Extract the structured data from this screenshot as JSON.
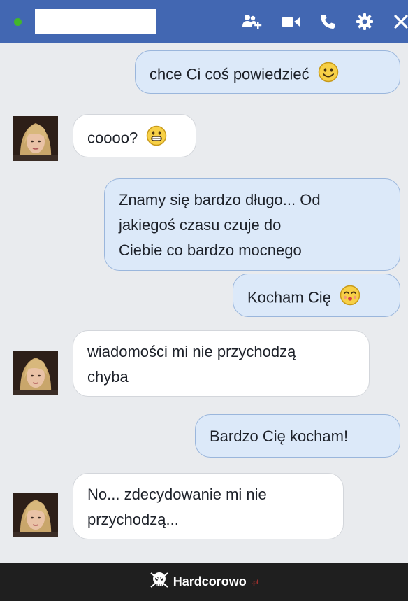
{
  "header": {
    "contact_name": "",
    "status": "online",
    "icons": [
      "add-friend-icon",
      "video-call-icon",
      "phone-icon",
      "gear-icon",
      "close-icon"
    ]
  },
  "messages": [
    {
      "from": "me",
      "text": "chce Ci coś powiedzieć",
      "emoji": "smile"
    },
    {
      "from": "them",
      "text": "coooo?",
      "emoji": "grin"
    },
    {
      "from": "me",
      "lines": [
        "Znamy się bardzo długo... Od",
        "jakiegoś czasu czuje do",
        "Ciebie co bardzo mocnego"
      ]
    },
    {
      "from": "me",
      "text": "Kocham Cię",
      "emoji": "kiss"
    },
    {
      "from": "them",
      "lines": [
        "wiadomości mi nie przychodzą",
        "chyba"
      ]
    },
    {
      "from": "me",
      "text": "Bardzo Cię kocham!"
    },
    {
      "from": "them",
      "lines": [
        "No... zdecydowanie mi nie",
        "przychodzą..."
      ]
    }
  ],
  "footer": {
    "brand": "Hardcorowo",
    "suffix": ".pl"
  },
  "colors": {
    "header": "#4267b2",
    "online": "#42b72a",
    "outgoing_bubble": "#dce9f9",
    "incoming_bubble": "#ffffff",
    "background": "#e9ebee"
  }
}
